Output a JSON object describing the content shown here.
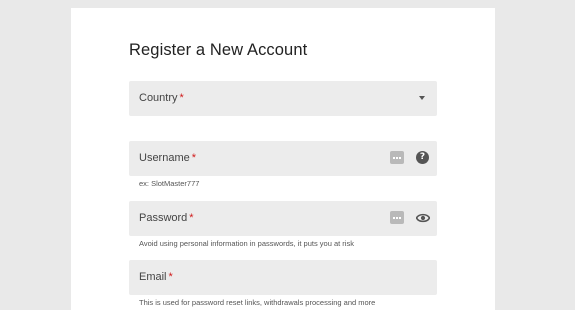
{
  "form": {
    "title": "Register a New Account",
    "required_marker": "*",
    "country": {
      "label": "Country",
      "icon": "chevron-down-icon"
    },
    "username": {
      "label": "Username",
      "hint": "ex: SlotMaster777",
      "icons": [
        "keyboard-icon",
        "help-icon"
      ],
      "help_glyph": "?"
    },
    "password": {
      "label": "Password",
      "hint": "Avoid using personal information in passwords, it puts you at risk",
      "icons": [
        "keyboard-icon",
        "eye-icon"
      ]
    },
    "email": {
      "label": "Email",
      "hint": "This is used for password reset links, withdrawals processing and more"
    }
  },
  "colors": {
    "page_bg": "#e9e9e9",
    "card_bg": "#ffffff",
    "field_bg": "#ececec",
    "required": "#d01a1a"
  }
}
